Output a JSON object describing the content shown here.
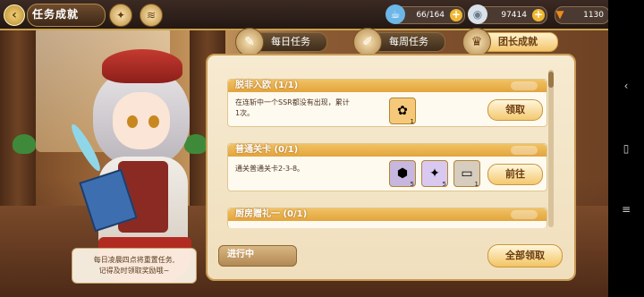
{
  "topbar": {
    "title": "任务成就",
    "stamina": "66/164",
    "gems": "97414",
    "carrots": "1130"
  },
  "tabs": [
    {
      "label": "每日任务",
      "active": false
    },
    {
      "label": "每周任务",
      "active": false
    },
    {
      "label": "团长成就",
      "active": true
    }
  ],
  "achievements": [
    {
      "title": "脱非入欧 (1/1)",
      "description_line1": "在连斩中一个SSR都没有出现，累计",
      "description_line2": "1次。",
      "rewards": [
        {
          "icon": "reward-gift-icon",
          "count": "1"
        }
      ],
      "button": "领取"
    },
    {
      "title": "普通关卡 (0/1)",
      "description_line1": "通关普通关卡2-3-8。",
      "description_line2": "",
      "rewards": [
        {
          "icon": "ore-icon",
          "count": "5"
        },
        {
          "icon": "crystal-icon",
          "count": "5"
        },
        {
          "icon": "table-icon",
          "count": "1"
        }
      ],
      "button": "前往"
    },
    {
      "title": "厨房赠礼一 (0/1)",
      "description_line1": "",
      "description_line2": "",
      "rewards": [],
      "button": ""
    }
  ],
  "footer": {
    "status_label": "进行中",
    "claim_all": "全部领取"
  },
  "hint": {
    "line1": "每日凌晨四点将重置任务,",
    "line2": "记得及时领取奖励哦~"
  },
  "colors": {
    "accent_gold": "#f2c56b",
    "panel_bg": "#f6ead0",
    "card_header": "#e3a43c"
  }
}
